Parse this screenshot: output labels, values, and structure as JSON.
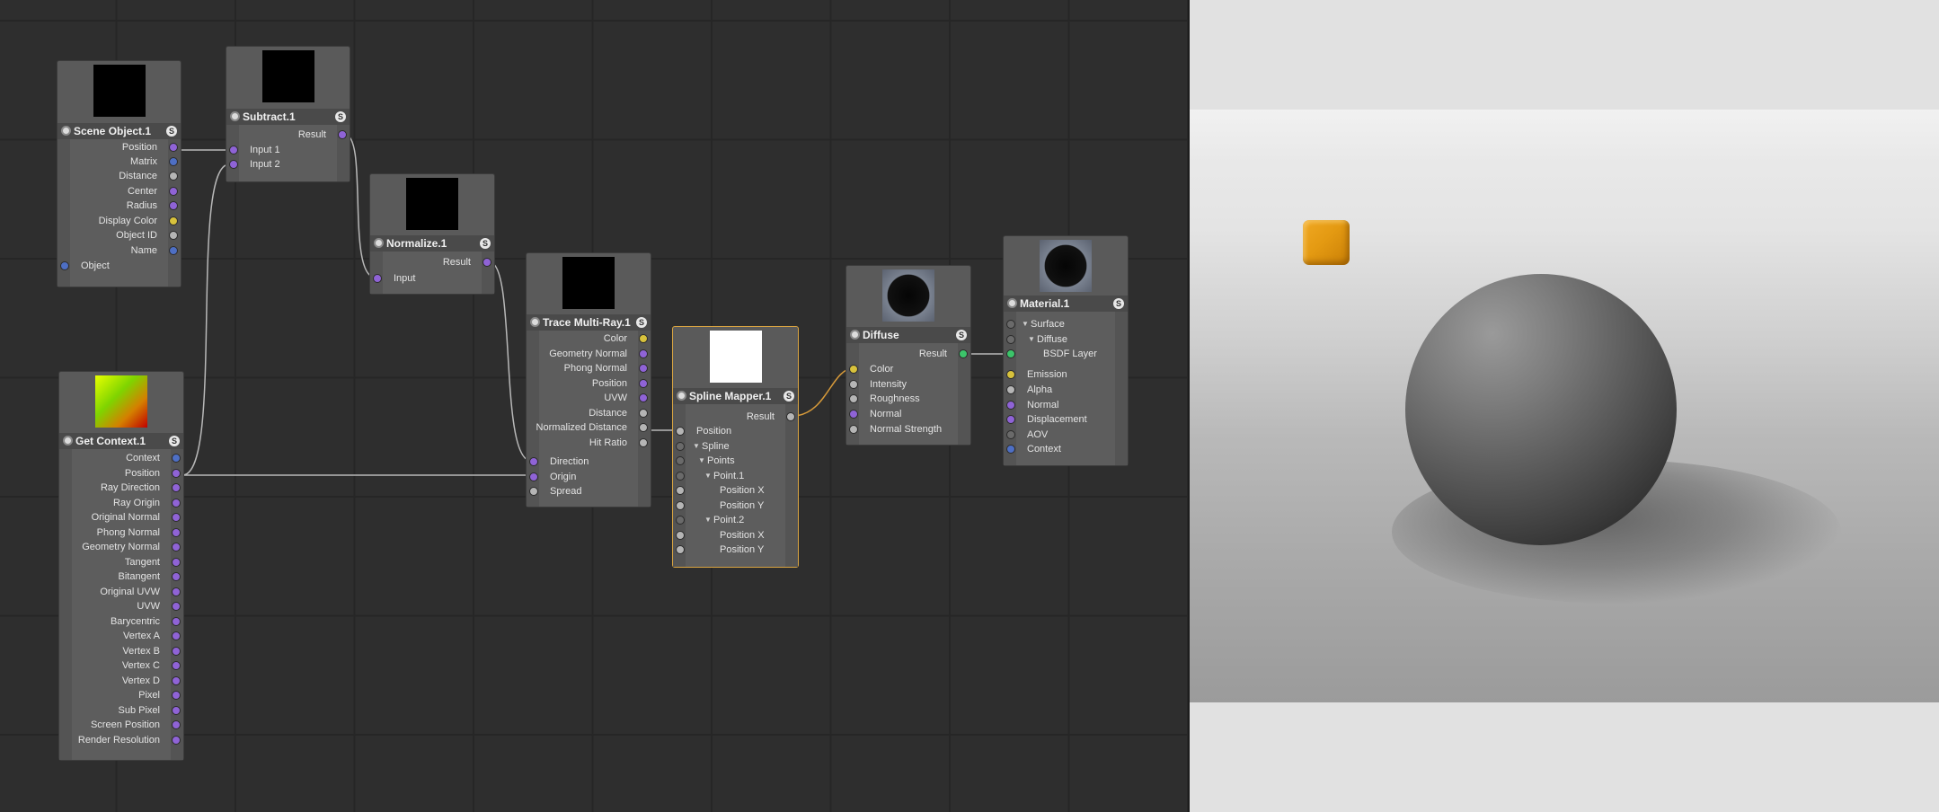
{
  "colors": {
    "port_purple": "#8f63d6",
    "port_blue": "#4e6fc4",
    "port_gray": "#b5b5b5",
    "port_yellow": "#d8c23c",
    "port_green": "#3cc46a",
    "port_dark": "#6a6a6a",
    "selection": "#d9a441",
    "cube": "#e49a12"
  },
  "nodes": {
    "scene_object": {
      "title": "Scene Object.1",
      "badge": "S",
      "outputs": [
        "Position",
        "Matrix",
        "Distance",
        "Center",
        "Radius",
        "Display Color",
        "Object ID",
        "Name"
      ],
      "output_colors": [
        "purple",
        "blue",
        "gray",
        "purple",
        "purple",
        "yellow",
        "gray",
        "blue"
      ],
      "inputs": [
        "Object"
      ]
    },
    "subtract": {
      "title": "Subtract.1",
      "badge": "S",
      "outputs": [
        "Result"
      ],
      "inputs": [
        "Input 1",
        "Input 2"
      ]
    },
    "normalize": {
      "title": "Normalize.1",
      "badge": "S",
      "outputs": [
        "Result"
      ],
      "inputs": [
        "Input"
      ]
    },
    "get_context": {
      "title": "Get Context.1",
      "badge": "S",
      "outputs": [
        "Context",
        "Position",
        "Ray Direction",
        "Ray Origin",
        "Original Normal",
        "Phong Normal",
        "Geometry Normal",
        "Tangent",
        "Bitangent",
        "Original UVW",
        "UVW",
        "Barycentric",
        "Vertex A",
        "Vertex B",
        "Vertex C",
        "Vertex D",
        "Pixel",
        "Sub Pixel",
        "Screen Position",
        "Render Resolution"
      ],
      "output_colors": [
        "blue",
        "purple",
        "purple",
        "purple",
        "purple",
        "purple",
        "purple",
        "purple",
        "purple",
        "purple",
        "purple",
        "purple",
        "purple",
        "purple",
        "purple",
        "purple",
        "purple",
        "purple",
        "purple",
        "purple"
      ]
    },
    "trace_multi_ray": {
      "title": "Trace Multi-Ray.1",
      "badge": "S",
      "outputs": [
        "Color",
        "Geometry Normal",
        "Phong Normal",
        "Position",
        "UVW",
        "Distance",
        "Normalized Distance",
        "Hit Ratio"
      ],
      "output_colors": [
        "yellow",
        "purple",
        "purple",
        "purple",
        "purple",
        "gray",
        "gray",
        "gray"
      ],
      "inputs": [
        "Direction",
        "Origin",
        "Spread"
      ],
      "input_colors": [
        "purple",
        "purple",
        "gray"
      ]
    },
    "spline_mapper": {
      "title": "Spline Mapper.1",
      "badge": "S",
      "outputs": [
        "Result"
      ],
      "inputs": [
        "Position",
        "Spline",
        "Points",
        "Point.1",
        "Position X",
        "Position Y",
        "Point.2",
        "Position X",
        "Position Y"
      ]
    },
    "diffuse": {
      "title": "Diffuse",
      "badge": "S",
      "outputs": [
        "Result"
      ],
      "inputs": [
        "Color",
        "Intensity",
        "Roughness",
        "Normal",
        "Normal Strength"
      ],
      "input_colors": [
        "yellow",
        "gray",
        "gray",
        "purple",
        "gray"
      ]
    },
    "material": {
      "title": "Material.1",
      "badge": "S",
      "inputs": [
        "Surface",
        "Diffuse",
        "BSDF Layer",
        "Emission",
        "Alpha",
        "Normal",
        "Displacement",
        "AOV",
        "Context"
      ],
      "input_colors": [
        "dark",
        "dark",
        "green",
        "yellow",
        "gray",
        "purple",
        "purple",
        "dark",
        "blue"
      ]
    }
  }
}
